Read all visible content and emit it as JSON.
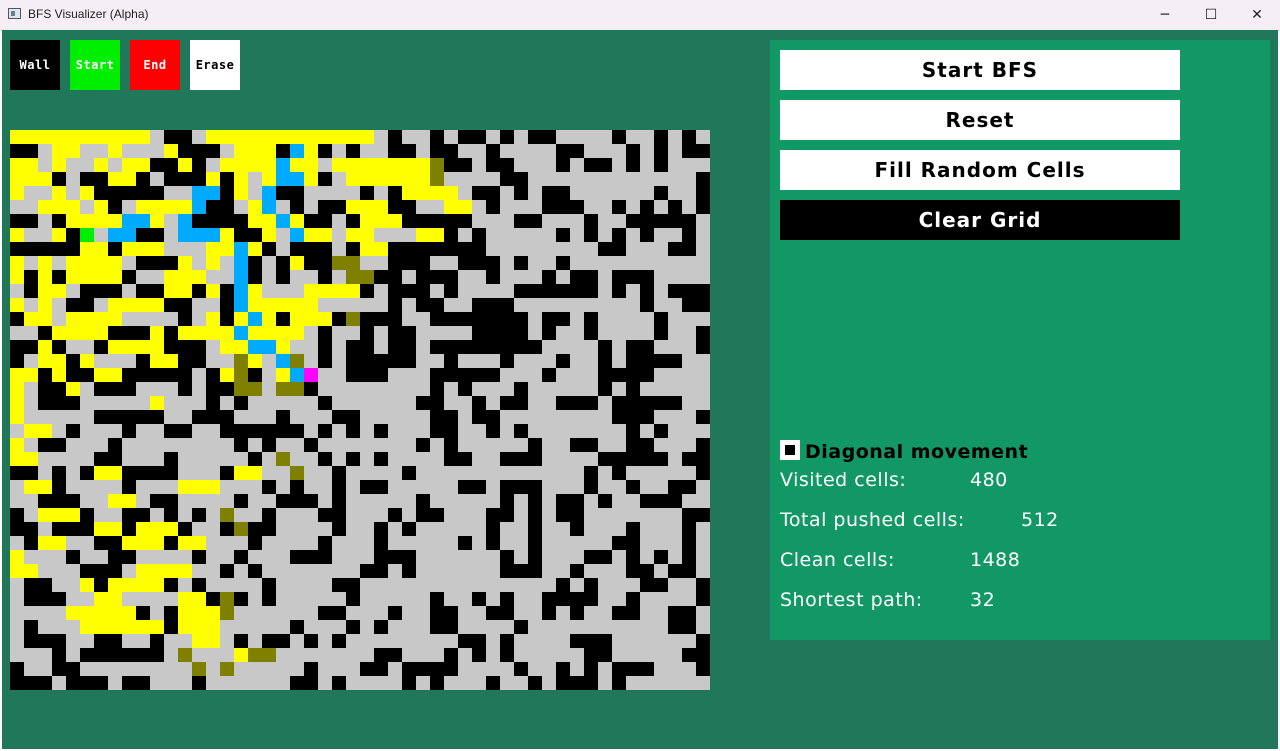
{
  "window": {
    "title": "BFS Visualizer (Alpha)",
    "minimize_glyph": "─",
    "maximize_glyph": "☐",
    "close_glyph": "✕"
  },
  "toolbar": {
    "wall_label": "Wall",
    "start_label": "Start",
    "end_label": "End",
    "erase_label": "Erase",
    "colors": {
      "wall": "#000000",
      "start": "#00ee00",
      "end": "#ff0000",
      "erase": "#ffffff"
    }
  },
  "panel": {
    "start_bfs_label": "Start BFS",
    "reset_label": "Reset",
    "fill_random_label": "Fill Random Cells",
    "clear_grid_label": "Clear Grid",
    "diagonal_label": "Diagonal movement",
    "diagonal_checked": true,
    "stats": {
      "visited_label": "Visited cells:",
      "visited_value": "480",
      "pushed_label": "Total pushed cells:",
      "pushed_value": "512",
      "clean_label": "Clean cells:",
      "clean_value": "1488",
      "shortest_label": "Shortest path:",
      "shortest_value": "32"
    }
  },
  "colors": {
    "background": "#20775a",
    "panel": "#129864",
    "clean_cell": "#c8c8c8",
    "wall_cell": "#000000",
    "visited_cell": "#ffff00",
    "frontier_cell": "#7f7f00",
    "path_cell": "#00aaff",
    "start_cell": "#00ee00",
    "end_cell": "#ff00ff"
  },
  "grid": {
    "cols": 50,
    "rows": 40,
    "rows_data": [
      "11111111110000111111111111000000000000000000000000",
      "00011001000100001110p10000000000000000000000000000",
      "1101001011001001111p1101111111f0000000000000000000",
      "1110000110000010101pp100111111f00000000000000000000",
      "1001010000000pp010p0000000001111000000000000000000",
      "0011101001111p0001p0000011100001100000000000000000",
      "00001111pp10p000011p100001110000000000000000000000",
      "10010s0pp000ppp10010p1101100011000000000000000000",
      "0000011011100011p1000000011000000000000000000000",
      "1010111100001010p000100ff00000000000000000000000000",
      "1010111100011100p0000000ff0000000000000000000000000",
      "0011000000011010p10001111000000000000000000000000",
      "1010000111100000p1111100000000000000000000000000",
      "01101111000000101p101110f0000000000000000000000",
      "0001111000101111p11110000000000000000000000000",
      "00100001111000011pp100000000000000000000000000",
      "0011010000110000f10pf000000000000000000000000000",
      "1101001100000001f001pe000000000000000000000000",
      "1000100000000000ff0ff0000000000000000000000000",
      "10000000001000000000000000000000000000000000",
      "100000000000000000000000000000000000000000000",
      "0110000000000000000000000000000000000000000000",
      "1000000000000000000000000000000000000000000000",
      "1100000000000000000f00000000000000000000000000",
      "00000011000000001100f000000000000000000000000",
      "011000000000111000000000000000000000000000000",
      "0000000110000000000000000000000000000000000000",
      "001110000000000f000000000000000000000000000000",
      "0000001101110000f00000000000000000000000000000",
      "0011000011101100000000000000000000000000000000",
      "1000000000000000000000000000000000000000000000",
      "1100000001111000000000000000000000000000000000",
      "0000010111100000000000000000000000000000000000",
      "000000110000110f000000000000000000000000000000",
      "000011111000111f000000000000000000000000000000",
      "00000111111011100000000000000000000000000000000",
      "0000000000000110000000000000000000000000000000",
      "000000000000f0001ff00000000000000000000000000000",
      "0000000000000f0f00000000000000000000000000000000",
      "000000000000000000000000000000000000000000000000"
    ]
  }
}
